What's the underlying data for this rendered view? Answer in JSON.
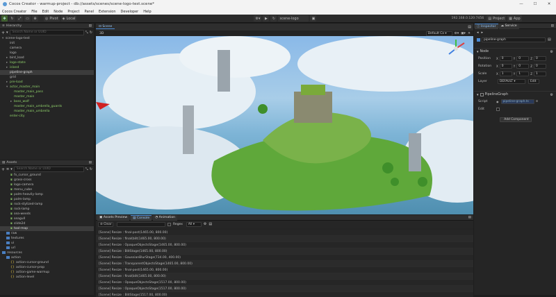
{
  "window": {
    "title": "Cocos Creator - warmup-project - db://assets/scenes/scene-logo-test.scene*",
    "controls": [
      "—",
      "☐",
      "✕"
    ]
  },
  "menu": [
    "Cocos Creator",
    "File",
    "Edit",
    "Node",
    "Project",
    "Panel",
    "Extension",
    "Developer",
    "Help"
  ],
  "toolbar": {
    "pivot_label": "Pivot",
    "local_label": "Local",
    "scene_selector": "scene-logo",
    "ip": "192.168.0.120:7456",
    "project_label": "Project",
    "app_label": "App"
  },
  "hierarchy": {
    "title": "Hierarchy",
    "search_placeholder": "Search Name or UUID",
    "rows": [
      {
        "label": "scene-logo-test",
        "green": false,
        "indent": 0,
        "arrow": "▾"
      },
      {
        "label": "init",
        "green": false,
        "indent": 1,
        "arrow": ""
      },
      {
        "label": "camera",
        "green": false,
        "indent": 1,
        "arrow": ""
      },
      {
        "label": "logo",
        "green": false,
        "indent": 1,
        "arrow": ""
      },
      {
        "label": "bird_load",
        "green": false,
        "indent": 1,
        "arrow": "▸"
      },
      {
        "label": "logo-state",
        "green": true,
        "indent": 1,
        "arrow": "▸"
      },
      {
        "label": "island",
        "green": true,
        "indent": 1,
        "arrow": "▸"
      },
      {
        "label": "pipeline-graph",
        "green": false,
        "indent": 1,
        "arrow": "",
        "selected": true
      },
      {
        "label": "grid",
        "green": false,
        "indent": 1,
        "arrow": ""
      },
      {
        "label": "pre-load",
        "green": true,
        "indent": 1,
        "arrow": "▸"
      },
      {
        "label": "actor_master_main",
        "green": true,
        "indent": 1,
        "arrow": "▾"
      },
      {
        "label": "master_main_pass",
        "green": true,
        "indent": 2,
        "arrow": ""
      },
      {
        "label": "master_main",
        "green": true,
        "indent": 2,
        "arrow": ""
      },
      {
        "label": "boss_wolf",
        "green": true,
        "indent": 2,
        "arrow": "▸"
      },
      {
        "label": "master_main_umbrella_guards",
        "green": true,
        "indent": 2,
        "arrow": ""
      },
      {
        "label": "master_main_umbrella",
        "green": true,
        "indent": 2,
        "arrow": ""
      },
      {
        "label": "enter-city",
        "green": true,
        "indent": 1,
        "arrow": ""
      }
    ]
  },
  "assets": {
    "title": "Assets",
    "search_placeholder": "Search Name or UUID",
    "rows": [
      {
        "label": "fx_cursor_ground",
        "type": "asset",
        "indent": 2
      },
      {
        "label": "grass-cross",
        "type": "asset",
        "indent": 2
      },
      {
        "label": "logo-camera",
        "type": "asset",
        "indent": 2
      },
      {
        "label": "menu_cube",
        "type": "asset",
        "indent": 2
      },
      {
        "label": "palm-heavily-lamp",
        "type": "asset",
        "indent": 2
      },
      {
        "label": "palm-lamp",
        "type": "asset",
        "indent": 2
      },
      {
        "label": "rock-stylized-lamp",
        "type": "asset",
        "indent": 2
      },
      {
        "label": "rock-lamp",
        "type": "asset",
        "indent": 2
      },
      {
        "label": "sea-weeds",
        "type": "asset",
        "indent": 2
      },
      {
        "label": "seagull",
        "type": "asset",
        "indent": 2
      },
      {
        "label": "slide2d",
        "type": "asset",
        "indent": 2
      },
      {
        "label": "tool-map",
        "type": "asset",
        "indent": 2,
        "selected": true
      },
      {
        "label": "raw",
        "type": "folder",
        "indent": 1
      },
      {
        "label": "textures",
        "type": "folder",
        "indent": 1
      },
      {
        "label": "ui",
        "type": "folder",
        "indent": 1
      },
      {
        "label": "url",
        "type": "folder",
        "indent": 1
      },
      {
        "label": "resources",
        "type": "folder",
        "indent": 0
      },
      {
        "label": "action",
        "type": "folder",
        "indent": 1
      },
      {
        "label": "action-cursor-ground",
        "type": "script",
        "indent": 2
      },
      {
        "label": "action-cursor-prop",
        "type": "script",
        "indent": 2
      },
      {
        "label": "action-game-warmup",
        "type": "script",
        "indent": 2
      },
      {
        "label": "action-level",
        "type": "script",
        "indent": 2
      }
    ]
  },
  "scene": {
    "tab_label": "Scene",
    "mode_3d": "3D",
    "default_dropdown": "Default Ca"
  },
  "console": {
    "tabs": [
      "Assets Preview",
      "Console",
      "Animation"
    ],
    "active_tab": "Console",
    "clear_label": "Clear",
    "regex_label": "Regex",
    "level_dropdown": "All",
    "rows": [
      "[Scene] Resize : final-post(1465.00, 800.00)",
      "[Scene] Resize : final(blit(1465.00, 800.00)",
      "[Scene] Resize : OpaqueObjectsStage(1465.00, 800.00)",
      "[Scene] Resize : BlitStage(1465.00, 800.00)",
      "[Scene] Resize : GaussianBlurStage(734.00, 400.00)",
      "[Scene] Resize : TransparentObjectsStage(1465.00, 800.00)",
      "[Scene] Resize : final-post(1465.00, 800.00)",
      "[Scene] Resize : final(blit(1465.00, 800.00)",
      "[Scene] Resize : OpaqueObjectsStage(1517.00, 800.00)",
      "[Scene] Resize : OpaqueObjectsStage(1517.00, 800.00)",
      "[Scene] Resize : BlitStage(1517.00, 800.00)"
    ]
  },
  "inspector": {
    "tabs": [
      "Inspector",
      "Service"
    ],
    "node_name": "pipeline-graph",
    "node_section": "Node",
    "position_label": "Position",
    "rotation_label": "Rotation",
    "scale_label": "Scale",
    "layer_label": "Layer",
    "layer_value": "DEFAULT",
    "edit_label": "Edit",
    "position": {
      "x": "0",
      "y": "0",
      "z": "0"
    },
    "rotation": {
      "x": "0",
      "y": "0",
      "z": "0"
    },
    "scale": {
      "x": "1",
      "y": "1",
      "z": "1"
    },
    "component_title": "PipelineGraph",
    "script_label": "Script",
    "script_value": "pipeline-graph.ts",
    "edit_field_label": "Edit",
    "add_component": "Add Component"
  },
  "colors": {
    "accent": "#4a8ad4",
    "green": "#8fd06a",
    "bg": "#1e1e1e"
  }
}
